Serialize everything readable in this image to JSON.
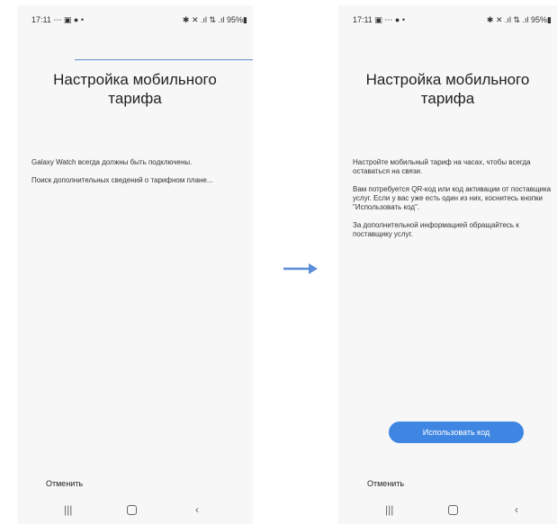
{
  "colors": {
    "accent": "#3f86e2",
    "arrow": "#5b8ed8",
    "screen_bg": "#f7f7f7"
  },
  "left_screen": {
    "status": {
      "time": "17:11",
      "left_icons": "⋯ ▣ ●  •",
      "right_icons": "✱ ✕ .ıl ⇅ .ıl 95%▮"
    },
    "title": "Настройка мобильного тарифа",
    "paragraphs": [
      "Galaxy Watch всегда должны быть подключены.",
      "Поиск дополнительных сведений о тарифном плане..."
    ],
    "cancel_label": "Отменить",
    "nav": {
      "recent": "|||",
      "back": "‹"
    }
  },
  "right_screen": {
    "status": {
      "time": "17:11",
      "left_icons": "▣ ⋯ ●  •",
      "right_icons": "✱ ✕ .ıl ⇅ .ıl 95%▮"
    },
    "title": "Настройка мобильного тарифа",
    "paragraphs": [
      "Настройте мобильный тариф на часах, чтобы всегда оставаться на связи.",
      "Вам потребуется QR-код или код активации от поставщика услуг. Если у вас уже есть один из них, коснитесь кнопки \"Использовать код\".",
      "За дополнительной информацией обращайтесь к поставщику услуг."
    ],
    "primary_button_label": "Использовать код",
    "cancel_label": "Отменить",
    "nav": {
      "recent": "|||",
      "back": "‹"
    }
  }
}
